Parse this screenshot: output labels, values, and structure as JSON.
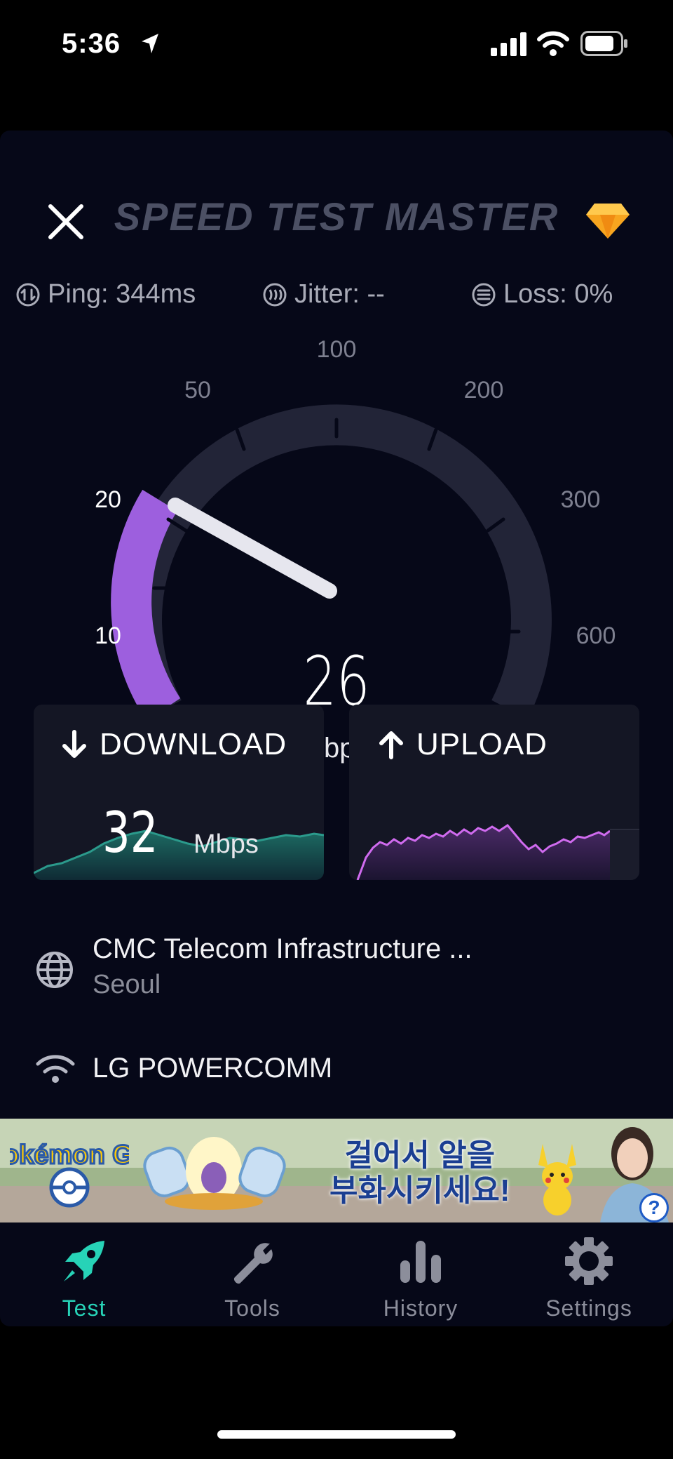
{
  "status_bar": {
    "time": "5:36"
  },
  "header": {
    "logo_text": "SPEED TEST MASTER"
  },
  "stats": {
    "ping": "Ping: 344ms",
    "jitter": "Jitter: --",
    "loss": "Loss: 0%"
  },
  "gauge": {
    "scale_labels": [
      "10",
      "20",
      "50",
      "100",
      "200",
      "300",
      "600"
    ],
    "current_speed": "26",
    "unit_fragment": "bp"
  },
  "download": {
    "label": "DOWNLOAD",
    "value": "32",
    "unit": "Mbps"
  },
  "upload": {
    "label": "UPLOAD"
  },
  "server": {
    "name": "CMC Telecom Infrastructure ...",
    "city": "Seoul"
  },
  "isp": {
    "name": "LG POWERCOMM"
  },
  "ad": {
    "brand": "Pokémon GO",
    "headline_line1": "걸어서 알을",
    "headline_line2": "부화시키세요!",
    "help": "?"
  },
  "tabs": [
    {
      "label": "Test",
      "icon": "rocket-icon",
      "active": true
    },
    {
      "label": "Tools",
      "icon": "wrench-icon",
      "active": false
    },
    {
      "label": "History",
      "icon": "bar-chart-icon",
      "active": false
    },
    {
      "label": "Settings",
      "icon": "gear-icon",
      "active": false
    }
  ],
  "colors": {
    "accent_teal": "#27d3b7",
    "gauge_purple": "#9d5fde",
    "upload_line": "#d06bef",
    "background": "#060818"
  }
}
